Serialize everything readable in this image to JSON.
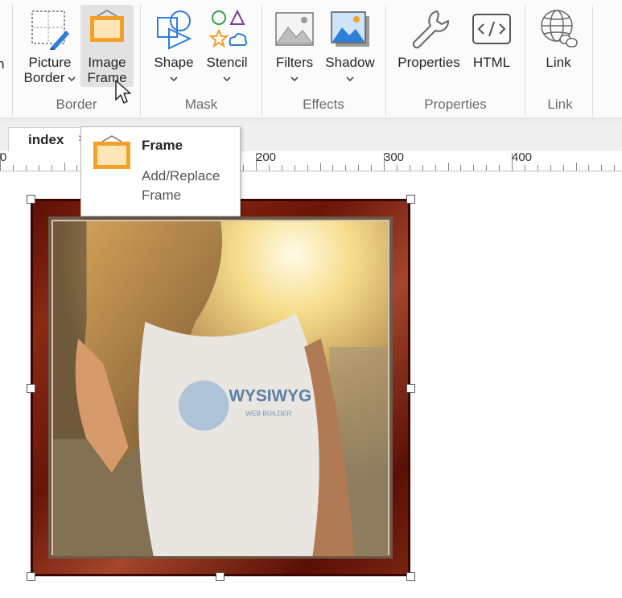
{
  "ribbon": {
    "cut_text": "n",
    "buttons": [
      {
        "id": "picture-border",
        "label1": "Picture",
        "label2": "Border",
        "dropdown": true,
        "icon": "picture-border-icon"
      },
      {
        "id": "image-frame",
        "label1": "Image",
        "label2": "Frame",
        "dropdown": false,
        "icon": "image-frame-icon",
        "active": true
      },
      {
        "id": "shape",
        "label1": "Shape",
        "dropdown": true,
        "icon": "shape-icon"
      },
      {
        "id": "stencil",
        "label1": "Stencil",
        "dropdown": true,
        "icon": "stencil-icon"
      },
      {
        "id": "filters",
        "label1": "Filters",
        "dropdown": true,
        "icon": "filters-icon"
      },
      {
        "id": "shadow",
        "label1": "Shadow",
        "dropdown": true,
        "icon": "shadow-icon"
      },
      {
        "id": "properties",
        "label1": "Properties",
        "dropdown": false,
        "icon": "wrench-icon"
      },
      {
        "id": "html",
        "label1": "HTML",
        "dropdown": false,
        "icon": "html-code-icon"
      },
      {
        "id": "link",
        "label1": "Link",
        "dropdown": false,
        "icon": "globe-link-icon"
      }
    ],
    "groups": {
      "border": "Border",
      "mask": "Mask",
      "effects": "Effects",
      "properties": "Properties",
      "link": "Link"
    }
  },
  "tabs": [
    {
      "label": "index",
      "close": "×"
    }
  ],
  "ruler": {
    "labels": [
      "0",
      "200",
      "300",
      "400"
    ]
  },
  "tooltip": {
    "title": "Frame",
    "description": "Add/Replace Frame"
  },
  "photo": {
    "shirt_text": "WYSIWYG",
    "shirt_subtext": "WEB BUILDER"
  },
  "colors": {
    "accent_orange": "#f4a02a",
    "frame_fill": "#fde6b8",
    "icon_blue": "#2f7ed8",
    "selection_bg": "#e2e2e2"
  }
}
